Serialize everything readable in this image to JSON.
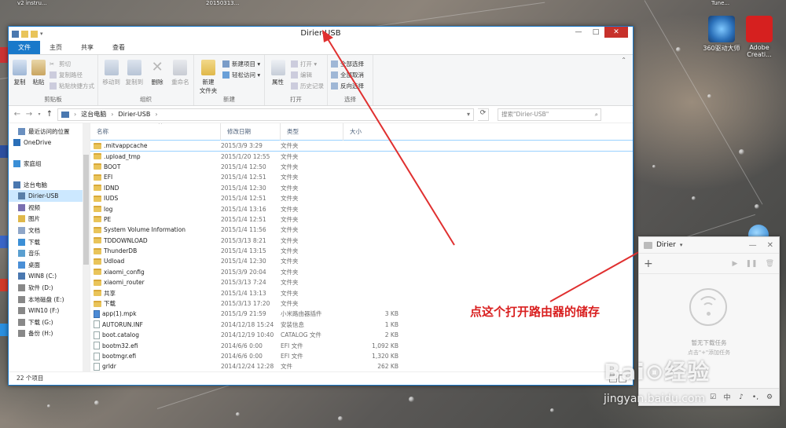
{
  "desktop_top": {
    "item1": "v2 instru...",
    "item2": "20150313...",
    "item3": "Tune..."
  },
  "desktop_icons": [
    {
      "label": "360驱动大师",
      "color": "#2a6fb8"
    },
    {
      "label": "Adobe Creati...",
      "color": "#d6201f"
    }
  ],
  "window": {
    "title": "Dirier-USB",
    "tabs": [
      "文件",
      "主页",
      "共享",
      "查看"
    ],
    "controls": {
      "minimize": "—",
      "maximize": "□",
      "close": "✕"
    }
  },
  "ribbon": {
    "clipboard": {
      "name": "剪贴板",
      "copy": "复制",
      "paste": "粘贴",
      "cut": "剪切",
      "copy_path": "复制路径",
      "paste_shortcut": "粘贴快捷方式"
    },
    "organize": {
      "name": "组织",
      "move_to": "移动到",
      "copy_to": "复制到",
      "delete": "删除",
      "rename": "重命名"
    },
    "new": {
      "name": "新建",
      "new_folder": "新建\n文件夹",
      "new_item": "新建项目 ▾",
      "easy_access": "轻松访问 ▾"
    },
    "open": {
      "name": "打开",
      "properties": "属性",
      "open": "打开 ▾",
      "edit": "编辑",
      "history": "历史记录"
    },
    "select": {
      "name": "选择",
      "select_all": "全部选择",
      "select_none": "全部取消",
      "invert": "反向选择"
    }
  },
  "address": {
    "back": "←",
    "forward": "→",
    "up": "↑",
    "path": [
      "这台电脑",
      "Dirier-USB"
    ],
    "search_placeholder": "搜索\"Dirier-USB\""
  },
  "nav_pane": [
    {
      "label": "最近访问的位置",
      "sub": true,
      "color": "#6a8fbf"
    },
    {
      "label": "OneDrive",
      "sub": false,
      "color": "#2a6fb8",
      "gap": true
    },
    {
      "label": "家庭组",
      "sub": false,
      "color": "#3b8fd6",
      "gap": true
    },
    {
      "label": "这台电脑",
      "sub": false,
      "color": "#4a78b0",
      "gap": true
    },
    {
      "label": "Dirier-USB",
      "sub": true,
      "color": "#5a7fa8",
      "selected": true
    },
    {
      "label": "视频",
      "sub": true,
      "color": "#7a6fb0"
    },
    {
      "label": "图片",
      "sub": true,
      "color": "#e0b84a"
    },
    {
      "label": "文档",
      "sub": true,
      "color": "#8fa6c8"
    },
    {
      "label": "下载",
      "sub": true,
      "color": "#3b8fd6"
    },
    {
      "label": "音乐",
      "sub": true,
      "color": "#5a9fd0"
    },
    {
      "label": "桌面",
      "sub": true,
      "color": "#4a8fd6"
    },
    {
      "label": "WIN8 (C:)",
      "sub": true,
      "color": "#4a78b0"
    },
    {
      "label": "软件 (D:)",
      "sub": true,
      "color": "#888888"
    },
    {
      "label": "本地磁盘 (E:)",
      "sub": true,
      "color": "#888888"
    },
    {
      "label": "WIN10 (F:)",
      "sub": true,
      "color": "#888888"
    },
    {
      "label": "下载 (G:)",
      "sub": true,
      "color": "#888888"
    },
    {
      "label": "备份 (H:)",
      "sub": true,
      "color": "#888888"
    }
  ],
  "file_list": {
    "headers": {
      "name": "名称",
      "date": "修改日期",
      "type": "类型",
      "size": "大小"
    },
    "rows": [
      {
        "name": ".mitvappcache",
        "date": "2015/3/9 3:29",
        "type": "文件夹",
        "size": "",
        "kind": "folder",
        "selected": true
      },
      {
        "name": ".upload_tmp",
        "date": "2015/1/20 12:55",
        "type": "文件夹",
        "size": "",
        "kind": "folder"
      },
      {
        "name": "BOOT",
        "date": "2015/1/4 12:50",
        "type": "文件夹",
        "size": "",
        "kind": "folder"
      },
      {
        "name": "EFI",
        "date": "2015/1/4 12:51",
        "type": "文件夹",
        "size": "",
        "kind": "folder"
      },
      {
        "name": "IDND",
        "date": "2015/1/4 12:30",
        "type": "文件夹",
        "size": "",
        "kind": "folder"
      },
      {
        "name": "IUDS",
        "date": "2015/1/4 12:51",
        "type": "文件夹",
        "size": "",
        "kind": "folder"
      },
      {
        "name": "log",
        "date": "2015/1/4 13:16",
        "type": "文件夹",
        "size": "",
        "kind": "folder"
      },
      {
        "name": "PE",
        "date": "2015/1/4 12:51",
        "type": "文件夹",
        "size": "",
        "kind": "folder"
      },
      {
        "name": "System Volume Information",
        "date": "2015/1/4 11:56",
        "type": "文件夹",
        "size": "",
        "kind": "folder"
      },
      {
        "name": "TDDOWNLOAD",
        "date": "2015/3/13 8:21",
        "type": "文件夹",
        "size": "",
        "kind": "folder"
      },
      {
        "name": "ThunderDB",
        "date": "2015/1/4 13:15",
        "type": "文件夹",
        "size": "",
        "kind": "folder"
      },
      {
        "name": "Udload",
        "date": "2015/1/4 12:30",
        "type": "文件夹",
        "size": "",
        "kind": "folder"
      },
      {
        "name": "xiaomi_config",
        "date": "2015/3/9 20:04",
        "type": "文件夹",
        "size": "",
        "kind": "folder"
      },
      {
        "name": "xiaomi_router",
        "date": "2015/3/13 7:24",
        "type": "文件夹",
        "size": "",
        "kind": "folder"
      },
      {
        "name": "共享",
        "date": "2015/1/4 13:13",
        "type": "文件夹",
        "size": "",
        "kind": "folder"
      },
      {
        "name": "下载",
        "date": "2015/3/13 17:20",
        "type": "文件夹",
        "size": "",
        "kind": "folder"
      },
      {
        "name": "app(1).mpk",
        "date": "2015/1/9 21:59",
        "type": "小米路由器插件",
        "size": "3 KB",
        "kind": "mpk"
      },
      {
        "name": "AUTORUN.INF",
        "date": "2014/12/18 15:24",
        "type": "安装信息",
        "size": "1 KB",
        "kind": "file"
      },
      {
        "name": "boot.catalog",
        "date": "2014/12/19 10:40",
        "type": "CATALOG 文件",
        "size": "2 KB",
        "kind": "file"
      },
      {
        "name": "bootm32.efi",
        "date": "2014/6/6 0:00",
        "type": "EFI 文件",
        "size": "1,092 KB",
        "kind": "file"
      },
      {
        "name": "bootmgr.efi",
        "date": "2014/6/6 0:00",
        "type": "EFI 文件",
        "size": "1,320 KB",
        "kind": "file"
      },
      {
        "name": "grldr",
        "date": "2014/12/24 12:28",
        "type": "文件",
        "size": "262 KB",
        "kind": "file"
      }
    ]
  },
  "status": {
    "count": "22 个项目"
  },
  "annotation": "点这个打开路由器的储存",
  "mini_panel": {
    "title": "Dirier",
    "dropdown": "▾",
    "minimize": "—",
    "close": "✕",
    "add": "+",
    "play": "▶",
    "pause": "❚❚",
    "trash": "🗑",
    "empty_msg": "暂无下载任务",
    "empty_sub": "点击\"+\"添加任务",
    "footer": [
      "☑",
      "中",
      "♪",
      "•,",
      "⚙"
    ]
  },
  "watermark": {
    "brand": "Bai⊙经验",
    "url": "jingyan.baidu.com"
  },
  "colors": {
    "accent": "#1979ca",
    "close": "#c7312b",
    "annotation": "#e03030"
  }
}
